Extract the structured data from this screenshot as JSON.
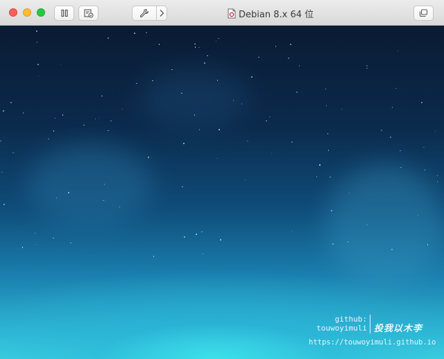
{
  "window": {
    "title": "Debian 8.x 64 位",
    "document_icon": "vm-document-icon"
  },
  "toolbar": {
    "pause_icon": "pause-icon",
    "snapshot_icon": "snapshot-icon",
    "settings_icon": "wrench-icon",
    "settings_menu_icon": "chevron-right-icon",
    "fullscreen_icon": "fullscreen-icon"
  },
  "watermark": {
    "github_label": "github:",
    "github_user": "touwoyimuli",
    "brand": "投我以木李",
    "url": "https://touwoyimuli.github.io"
  },
  "colors": {
    "close": "#fe5f57",
    "minimize": "#febc2e",
    "maximize": "#28c840",
    "desktop_top": "#0a1b33",
    "desktop_bottom": "#3fd3e2"
  }
}
